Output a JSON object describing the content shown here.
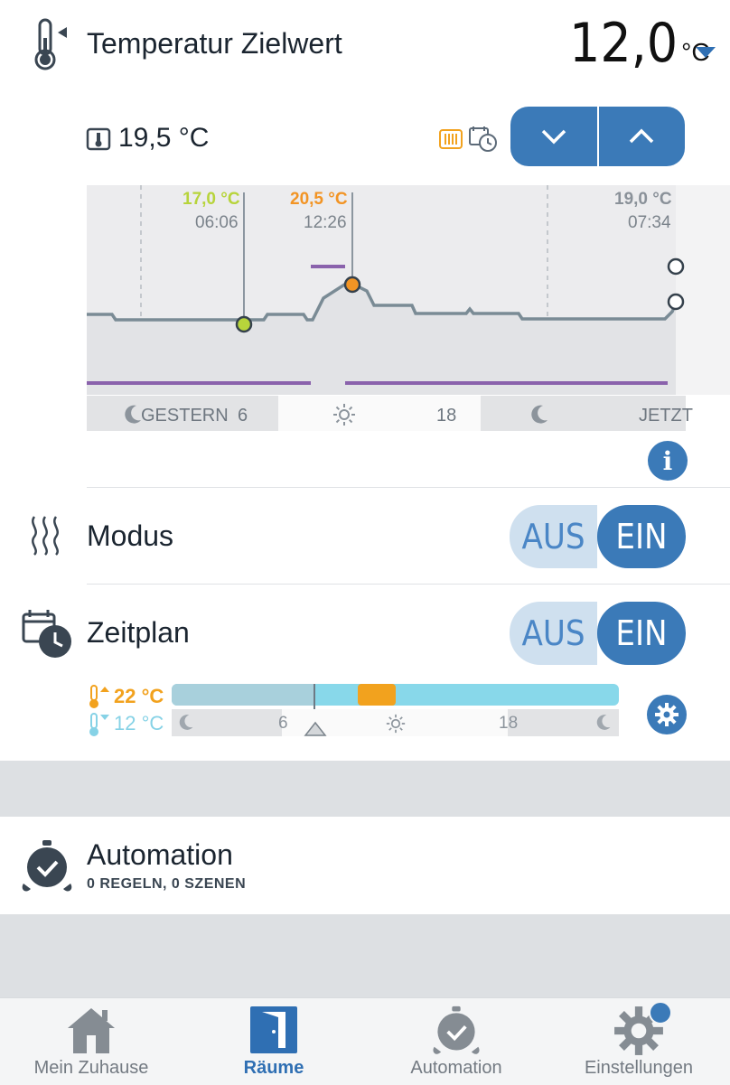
{
  "header": {
    "title": "Temperatur Zielwert",
    "target_value": "12,0",
    "target_unit": "°C"
  },
  "current": {
    "value": "19,5 °C"
  },
  "chart": {
    "markers": [
      {
        "temp": "17,0 °C",
        "time": "06:06",
        "color": "#b7d43b"
      },
      {
        "temp": "20,5 °C",
        "time": "12:26",
        "color": "#f29424"
      },
      {
        "temp": "19,0 °C",
        "time": "07:34",
        "color": "#8a9199"
      }
    ],
    "axis_labels": {
      "start": "GESTERN",
      "six": "6",
      "eighteen": "18",
      "end": "JETZT"
    }
  },
  "mode": {
    "label": "Modus",
    "off": "AUS",
    "on": "EIN",
    "state": "EIN"
  },
  "schedule": {
    "label": "Zeitplan",
    "off": "AUS",
    "on": "EIN",
    "state": "EIN",
    "high_temp": "22 °C",
    "low_temp": "12 °C",
    "axis_six": "6",
    "axis_eighteen": "18",
    "colors": {
      "high": "#f2a21e",
      "low": "#86d2e6"
    }
  },
  "automation": {
    "title": "Automation",
    "subtitle": "0 REGELN, 0 SZENEN"
  },
  "tabbar": {
    "items": [
      {
        "label": "Mein Zuhause",
        "icon": "house-icon"
      },
      {
        "label": "Räume",
        "icon": "door-icon",
        "active": true
      },
      {
        "label": "Automation",
        "icon": "alarm-clock-icon"
      },
      {
        "label": "Einstellungen",
        "icon": "gear-icon",
        "badge": true
      }
    ]
  },
  "colors": {
    "accent": "#3b7ab8",
    "purple": "#8a62ac",
    "graph_line": "#7a8b95"
  }
}
